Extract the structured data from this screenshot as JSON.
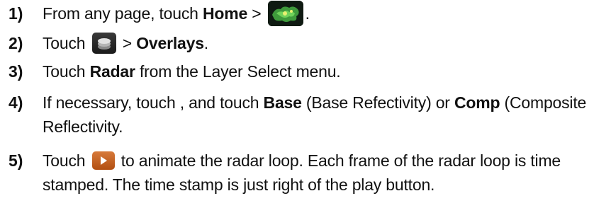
{
  "steps": [
    {
      "number": "1)",
      "prefix": "From any page, touch ",
      "bold": "Home",
      "suffix": " > ",
      "end": ".",
      "icon": "weather-map-icon"
    },
    {
      "number": "2)",
      "prefix": "Touch ",
      "mid": " > ",
      "bold": "Overlays",
      "end": ".",
      "icon": "layers-icon"
    },
    {
      "number": "3)",
      "prefix": "Touch ",
      "bold": "Radar",
      "suffix": " from the Layer Select menu."
    },
    {
      "number": "4)",
      "prefix": "If necessary, touch , and touch ",
      "bold1": "Base",
      "mid": " (Base Refectivity) or ",
      "bold2": "Comp",
      "suffix": " (Composite",
      "line2": "Reflectivity."
    },
    {
      "number": "5)",
      "prefix": "Touch ",
      "suffix": " to animate the radar loop.  Each frame of the radar loop is time",
      "line2": "stamped.  The time stamp is just right of the play button.",
      "icon": "play-icon"
    }
  ]
}
